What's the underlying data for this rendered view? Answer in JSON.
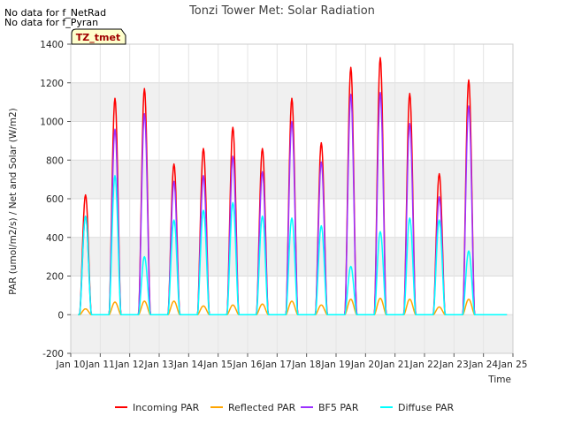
{
  "notes": [
    "No data for f_NetRad",
    "No data for f_Pyran"
  ],
  "chart_data": {
    "type": "line",
    "title": "Tonzi Tower Met: Solar Radiation",
    "xlabel": "Time",
    "ylabel": "PAR (umol/m2/s) / Net and Solar (W/m2)",
    "badge": "TZ_tmet",
    "xlim": [
      10,
      25
    ],
    "ylim": [
      -200,
      1400
    ],
    "xticks": [
      10,
      11,
      12,
      13,
      14,
      15,
      16,
      17,
      18,
      19,
      20,
      21,
      22,
      23,
      24,
      25
    ],
    "xtick_labels": [
      "Jan 10",
      "Jan 11",
      "Jan 12",
      "Jan 13",
      "Jan 14",
      "Jan 15",
      "Jan 16",
      "Jan 17",
      "Jan 18",
      "Jan 19",
      "Jan 20",
      "Jan 21",
      "Jan 22",
      "Jan 23",
      "Jan 24",
      "Jan 25"
    ],
    "yticks": [
      -200,
      0,
      200,
      400,
      600,
      800,
      1000,
      1200,
      1400
    ],
    "ytick_labels": [
      "-200",
      "0",
      "200",
      "400",
      "600",
      "800",
      "1000",
      "1200",
      "1400"
    ],
    "grid": true,
    "legend_position": "bottom",
    "days": [
      10,
      11,
      12,
      13,
      14,
      15,
      16,
      17,
      18,
      19,
      20,
      21,
      22,
      23,
      24
    ],
    "series": [
      {
        "name": "Incoming PAR",
        "color": "#ff0000",
        "daily_peaks": [
          620,
          1120,
          1170,
          780,
          860,
          970,
          860,
          1120,
          890,
          1280,
          1330,
          1145,
          730,
          1215
        ]
      },
      {
        "name": "Reflected PAR",
        "color": "#ffa500",
        "daily_peaks": [
          30,
          65,
          70,
          70,
          45,
          50,
          55,
          70,
          50,
          80,
          85,
          80,
          40,
          80
        ]
      },
      {
        "name": "BF5 PAR",
        "color": "#9b30ff",
        "daily_peaks": [
          510,
          960,
          1040,
          690,
          720,
          820,
          740,
          1000,
          790,
          1140,
          1150,
          990,
          610,
          1080
        ]
      },
      {
        "name": "Diffuse PAR",
        "color": "#00ffff",
        "daily_peaks": [
          510,
          720,
          300,
          490,
          540,
          580,
          510,
          500,
          460,
          250,
          430,
          500,
          490,
          330
        ]
      }
    ]
  }
}
